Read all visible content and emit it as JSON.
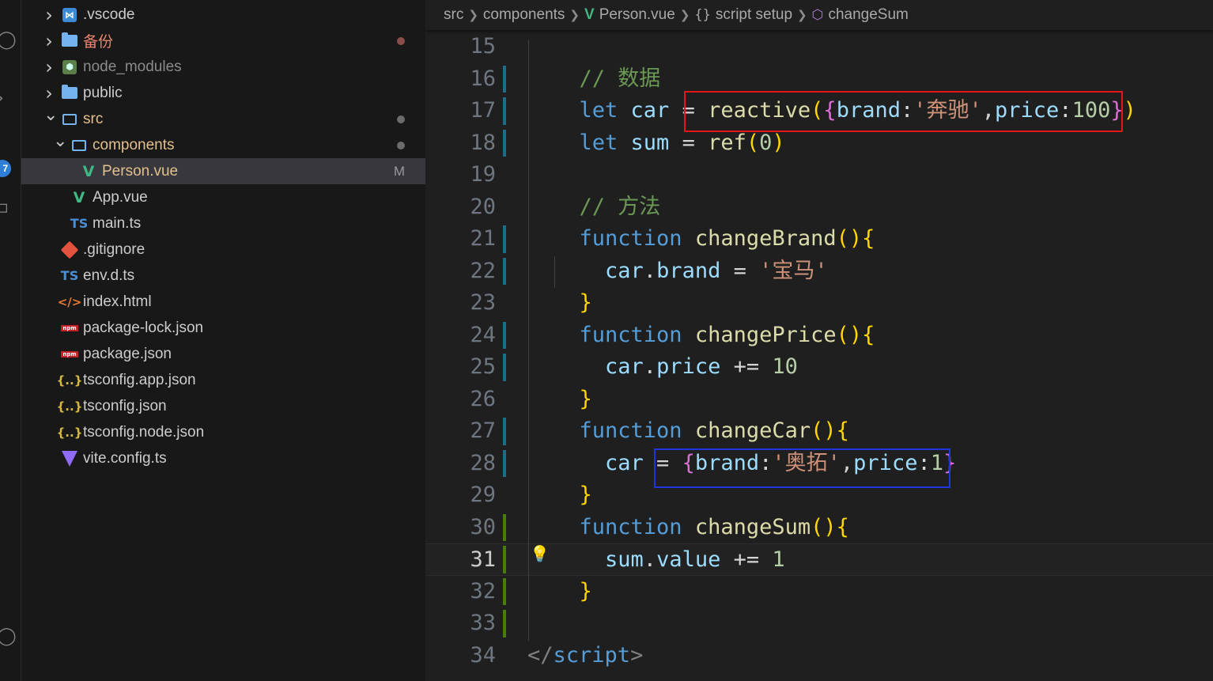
{
  "explorer": {
    "items": [
      {
        "label": ".vscode",
        "icon": "vscode-icon",
        "chevron": "right",
        "depth": 0,
        "decoration": "",
        "color": "#cccccc"
      },
      {
        "label": "备份",
        "icon": "folder-icon",
        "chevron": "right",
        "depth": 0,
        "decoration": "dot-red",
        "color": "#e8836f"
      },
      {
        "label": "node_modules",
        "icon": "node-modules-icon",
        "chevron": "right",
        "depth": 0,
        "decoration": "",
        "color": "#8b8b8b"
      },
      {
        "label": "public",
        "icon": "folder-icon",
        "chevron": "right",
        "depth": 0,
        "decoration": "",
        "color": "#cccccc"
      },
      {
        "label": "src",
        "icon": "folder-open-icon",
        "chevron": "down",
        "depth": 0,
        "decoration": "dot",
        "color": "#e2c08d"
      },
      {
        "label": "components",
        "icon": "folder-open-icon",
        "chevron": "down",
        "depth": 1,
        "decoration": "dot",
        "color": "#e2c08d"
      },
      {
        "label": "Person.vue",
        "icon": "vue-icon",
        "chevron": "",
        "depth": 2,
        "decoration": "M",
        "color": "#e2c08d",
        "selected": true
      },
      {
        "label": "App.vue",
        "icon": "vue-icon",
        "chevron": "",
        "depth": 1,
        "decoration": "",
        "color": "#cccccc"
      },
      {
        "label": "main.ts",
        "icon": "typescript-icon",
        "chevron": "",
        "depth": 1,
        "decoration": "",
        "color": "#cccccc"
      },
      {
        "label": ".gitignore",
        "icon": "git-icon",
        "chevron": "",
        "depth": 0,
        "decoration": "",
        "color": "#cccccc"
      },
      {
        "label": "env.d.ts",
        "icon": "typescript-icon",
        "chevron": "",
        "depth": 0,
        "decoration": "",
        "color": "#cccccc"
      },
      {
        "label": "index.html",
        "icon": "html-icon",
        "chevron": "",
        "depth": 0,
        "decoration": "",
        "color": "#cccccc"
      },
      {
        "label": "package-lock.json",
        "icon": "npm-icon",
        "chevron": "",
        "depth": 0,
        "decoration": "",
        "color": "#cccccc"
      },
      {
        "label": "package.json",
        "icon": "npm-icon",
        "chevron": "",
        "depth": 0,
        "decoration": "",
        "color": "#cccccc"
      },
      {
        "label": "tsconfig.app.json",
        "icon": "json-icon",
        "chevron": "",
        "depth": 0,
        "decoration": "",
        "color": "#cccccc"
      },
      {
        "label": "tsconfig.json",
        "icon": "json-icon",
        "chevron": "",
        "depth": 0,
        "decoration": "",
        "color": "#cccccc"
      },
      {
        "label": "tsconfig.node.json",
        "icon": "json-icon",
        "chevron": "",
        "depth": 0,
        "decoration": "",
        "color": "#cccccc"
      },
      {
        "label": "vite.config.ts",
        "icon": "vite-icon",
        "chevron": "",
        "depth": 0,
        "decoration": "",
        "color": "#cccccc"
      }
    ]
  },
  "activity_bar": {
    "badge": "7"
  },
  "breadcrumb": {
    "src": "src",
    "components": "components",
    "file": "Person.vue",
    "scope": "script setup",
    "symbol": "changeSum"
  },
  "editor": {
    "active_line": 31,
    "lines": [
      {
        "num": "15",
        "tokens": []
      },
      {
        "num": "16",
        "tokens": [
          [
            "c",
            "  // 数据"
          ]
        ]
      },
      {
        "num": "17",
        "tokens": [
          [
            "k",
            "  let "
          ],
          [
            "v",
            "car"
          ],
          [
            "p",
            " = "
          ],
          [
            "f",
            "reactive"
          ],
          [
            "b1",
            "("
          ],
          [
            "b2",
            "{"
          ],
          [
            "v",
            "brand"
          ],
          [
            "p",
            ":"
          ],
          [
            "s",
            "'奔驰'"
          ],
          [
            "p",
            ","
          ],
          [
            "v",
            "price"
          ],
          [
            "p",
            ":"
          ],
          [
            "n",
            "100"
          ],
          [
            "b2",
            "}"
          ],
          [
            "b1",
            ")"
          ]
        ]
      },
      {
        "num": "18",
        "tokens": [
          [
            "k",
            "  let "
          ],
          [
            "v",
            "sum"
          ],
          [
            "p",
            " = "
          ],
          [
            "f",
            "ref"
          ],
          [
            "b1",
            "("
          ],
          [
            "n",
            "0"
          ],
          [
            "b1",
            ")"
          ]
        ]
      },
      {
        "num": "19",
        "tokens": []
      },
      {
        "num": "20",
        "tokens": [
          [
            "c",
            "  // 方法"
          ]
        ]
      },
      {
        "num": "21",
        "tokens": [
          [
            "k",
            "  function "
          ],
          [
            "f",
            "changeBrand"
          ],
          [
            "b1",
            "(){"
          ]
        ]
      },
      {
        "num": "22",
        "tokens": [
          [
            "v",
            "    car"
          ],
          [
            "p",
            "."
          ],
          [
            "v",
            "brand"
          ],
          [
            "p",
            " = "
          ],
          [
            "s",
            "'宝马'"
          ]
        ]
      },
      {
        "num": "23",
        "tokens": [
          [
            "b1",
            "  }"
          ]
        ]
      },
      {
        "num": "24",
        "tokens": [
          [
            "k",
            "  function "
          ],
          [
            "f",
            "changePrice"
          ],
          [
            "b1",
            "(){"
          ]
        ]
      },
      {
        "num": "25",
        "tokens": [
          [
            "v",
            "    car"
          ],
          [
            "p",
            "."
          ],
          [
            "v",
            "price"
          ],
          [
            "p",
            " += "
          ],
          [
            "n",
            "10"
          ]
        ]
      },
      {
        "num": "26",
        "tokens": [
          [
            "b1",
            "  }"
          ]
        ]
      },
      {
        "num": "27",
        "tokens": [
          [
            "k",
            "  function "
          ],
          [
            "f",
            "changeCar"
          ],
          [
            "b1",
            "(){"
          ]
        ]
      },
      {
        "num": "28",
        "tokens": [
          [
            "v",
            "    car"
          ],
          [
            "p",
            " = "
          ],
          [
            "b2",
            "{"
          ],
          [
            "v",
            "brand"
          ],
          [
            "p",
            ":"
          ],
          [
            "s",
            "'奥拓'"
          ],
          [
            "p",
            ","
          ],
          [
            "v",
            "price"
          ],
          [
            "p",
            ":"
          ],
          [
            "n",
            "1"
          ],
          [
            "b2",
            "}"
          ]
        ]
      },
      {
        "num": "29",
        "tokens": [
          [
            "b1",
            "  }"
          ]
        ]
      },
      {
        "num": "30",
        "tokens": [
          [
            "k",
            "  function "
          ],
          [
            "f",
            "changeSum"
          ],
          [
            "b1",
            "(){"
          ]
        ]
      },
      {
        "num": "31",
        "tokens": [
          [
            "v",
            "    sum"
          ],
          [
            "p",
            "."
          ],
          [
            "v",
            "value"
          ],
          [
            "p",
            " += "
          ],
          [
            "n",
            "1"
          ]
        ]
      },
      {
        "num": "32",
        "tokens": [
          [
            "b1",
            "  }"
          ]
        ]
      },
      {
        "num": "33",
        "tokens": []
      },
      {
        "num": "34",
        "tokens": [
          [
            "t",
            "</"
          ],
          [
            "k",
            "script"
          ],
          [
            "t",
            ">"
          ]
        ]
      }
    ]
  },
  "colors": {
    "highlight_red": "#e3161b",
    "highlight_blue": "#2035e0",
    "modified": "#e2c08d"
  }
}
